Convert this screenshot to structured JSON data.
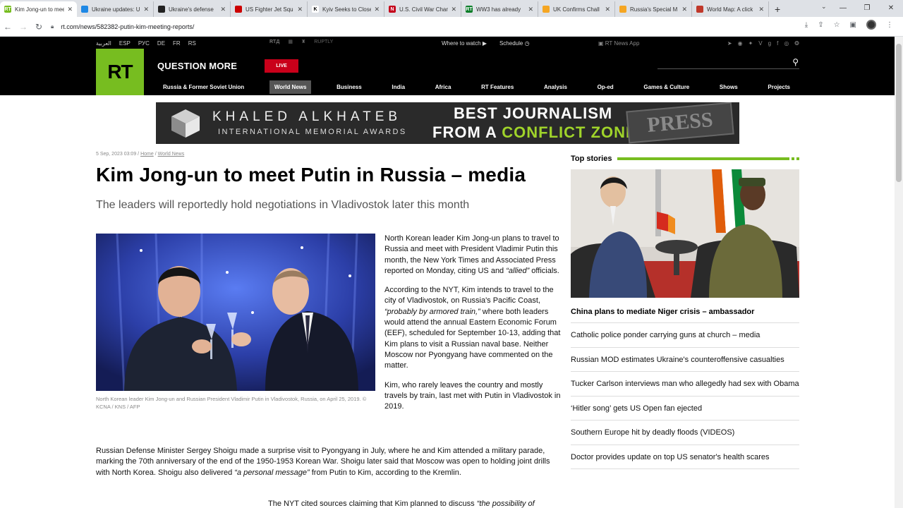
{
  "browser": {
    "tabs": [
      {
        "title": "Kim Jong-un to meet",
        "favicon_color": "#77bd20",
        "favicon": "RT",
        "active": true
      },
      {
        "title": "Ukraine updates: U",
        "favicon_color": "#1e88e5",
        "favicon": "",
        "active": false
      },
      {
        "title": "Ukraine's defense",
        "favicon_color": "#222222",
        "favicon": "",
        "active": false
      },
      {
        "title": "US Fighter Jet Squ",
        "favicon_color": "#cc0000",
        "favicon": "",
        "active": false
      },
      {
        "title": "Kyiv Seeks to Close",
        "favicon_color": "#ffffff",
        "favicon": "K",
        "active": false
      },
      {
        "title": "U.S. Civil War Chan",
        "favicon_color": "#c4001a",
        "favicon": "N",
        "active": false
      },
      {
        "title": "WW3 has already",
        "favicon_color": "#0a7d28",
        "favicon": "RT",
        "active": false
      },
      {
        "title": "UK Confirms Chall",
        "favicon_color": "#f5a623",
        "favicon": "",
        "active": false
      },
      {
        "title": "Russia's Special M",
        "favicon_color": "#f5a623",
        "favicon": "",
        "active": false
      },
      {
        "title": "World Map: A click",
        "favicon_color": "#c0392b",
        "favicon": "",
        "active": false
      }
    ],
    "url": "rt.com/news/582382-putin-kim-meeting-reports/"
  },
  "topbar": {
    "languages": [
      "العربية",
      "ESP",
      "РУС",
      "DE",
      "FR",
      "RS"
    ],
    "media": [
      "RUPTLY"
    ],
    "where_to_watch": "Where to watch",
    "schedule": "Schedule",
    "app": "RT News App"
  },
  "header": {
    "logo": "RT",
    "tagline": "QUESTION MORE",
    "live": "LIVE",
    "nav": [
      "Russia & Former Soviet Union",
      "World News",
      "Business",
      "India",
      "Africa",
      "RT Features",
      "Analysis",
      "Op-ed",
      "Games & Culture",
      "Shows",
      "Projects"
    ],
    "active_nav": "World News"
  },
  "banner": {
    "line1": "KHALED ALKHATEB",
    "line2": "INTERNATIONAL MEMORIAL AWARDS",
    "line3": "BEST JOURNALISM",
    "line4_pre": "FROM A",
    "line4_accent": "CONFLICT ZONE",
    "stamp": "PRESS"
  },
  "article": {
    "date": "5 Sep, 2023 03:09",
    "crumb_home": "Home",
    "crumb_section": "World News",
    "title": "Kim Jong-un to meet Putin in Russia – media",
    "summary": "The leaders will reportedly hold negotiations in Vladivostok later this month",
    "caption": "North Korean leader Kim Jong-un and Russian President Vladimir Putin in Vladivostok, Russia, on April 25, 2019. © KCNA / KNS / AFP",
    "p1_a": "North Korean leader Kim Jong-un plans to travel to Russia and meet with President Vladimir Putin this month, the New York Times and Associated Press reported on Monday, citing US and ",
    "p1_em": "“allied”",
    "p1_b": " officials.",
    "p2_a": "According to the NYT, Kim intends to travel to the city of Vladivostok, on Russia's Pacific Coast, ",
    "p2_em": "“probably by armored train,”",
    "p2_b": " where both leaders would attend the annual Eastern Economic Forum (EEF), scheduled for September 10-13, adding that Kim plans to visit a Russian naval base. Neither Moscow nor Pyongyang have commented on the matter.",
    "p3": "Kim, who rarely leaves the country and mostly travels by train, last met with Putin in Vladivostok in 2019.",
    "p4_a": "Russian Defense Minister Sergey Shoigu made a surprise visit to Pyongyang in July, where he and Kim attended a military parade, marking the 70th anniversary of the end of the 1950-1953 Korean War. Shoigu later said that Moscow was open to holding joint drills with North Korea. Shoigu also delivered ",
    "p4_em": "“a personal message”",
    "p4_b": " from Putin to Kim, according to the Kremlin.",
    "p5_a": "The NYT cited sources claiming that Kim planned to discuss ",
    "p5_em": "“the possibility of"
  },
  "top_stories": {
    "heading": "Top stories",
    "main": "China plans to mediate Niger crisis – ambassador",
    "items": [
      "Catholic police ponder carrying guns at church – media",
      "Russian MOD estimates Ukraine's counteroffensive casualties",
      "Tucker Carlson interviews man who allegedly had sex with Obama",
      "‘Hitler song’ gets US Open fan ejected",
      "Southern Europe hit by deadly floods (VIDEOS)",
      "Doctor provides update on top US senator's health scares"
    ]
  },
  "colors": {
    "accent": "#77bd20",
    "live": "#c9001a"
  }
}
